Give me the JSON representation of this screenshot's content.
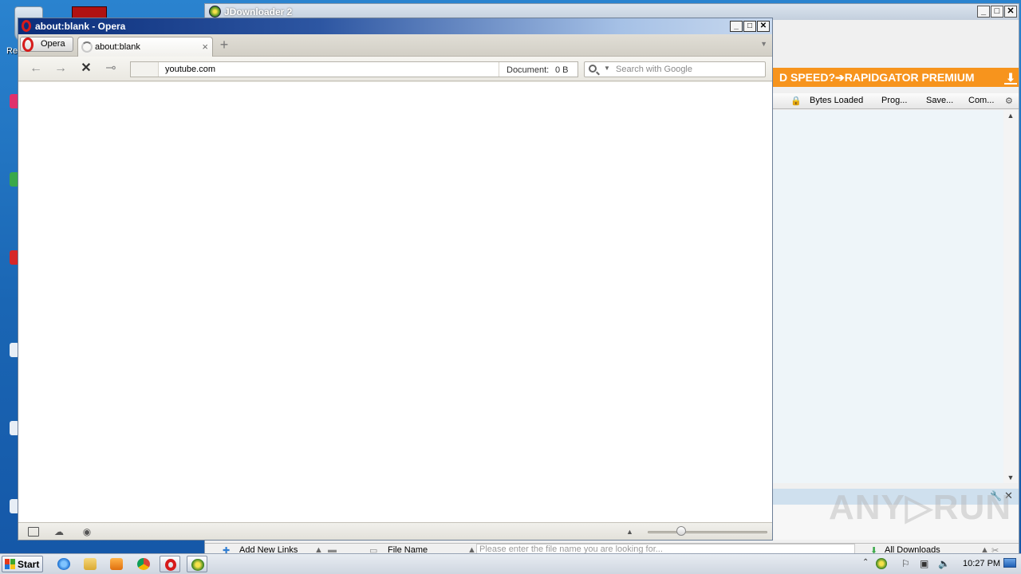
{
  "desktop": {
    "recycle_label": "Re"
  },
  "jdownloader": {
    "title": "JDownloader 2",
    "controls": {
      "minimize": "_",
      "maximize": "□",
      "close": "✕"
    },
    "banner_text": "D SPEED?➔RAPIDGATOR PREMIUM",
    "columns": [
      "Bytes Loaded",
      "Prog...",
      "Save...",
      "Com..."
    ],
    "bottom": {
      "add_links": "Add New Links",
      "file_name": "File Name",
      "filter_placeholder": "Please enter the file name you are looking for...",
      "all_downloads": "All Downloads"
    },
    "watermark": "ANY▷RUN"
  },
  "opera": {
    "window_title": "about:blank - Opera",
    "controls": {
      "minimize": "_",
      "maximize": "□",
      "close": "✕"
    },
    "menu_label": "Opera",
    "tab": {
      "title": "about:blank",
      "close": "×"
    },
    "new_tab": "+",
    "address": {
      "value": "youtube.com",
      "document_label": "Document:",
      "document_size": "0 B"
    },
    "search": {
      "placeholder": "Search with Google"
    },
    "nav": {
      "back": "←",
      "forward": "→",
      "stop": "✕",
      "key": "⊸"
    }
  },
  "taskbar": {
    "start_label": "Start",
    "clock": "10:27 PM",
    "apps": [
      "internet-explorer",
      "file-explorer",
      "media-player",
      "chrome",
      "opera",
      "jdownloader"
    ],
    "active_app": "opera"
  },
  "colors": {
    "opera_title_start": "#0b2e7a",
    "jd_banner": "#f7941d",
    "opera_red": "#d61b1b"
  }
}
